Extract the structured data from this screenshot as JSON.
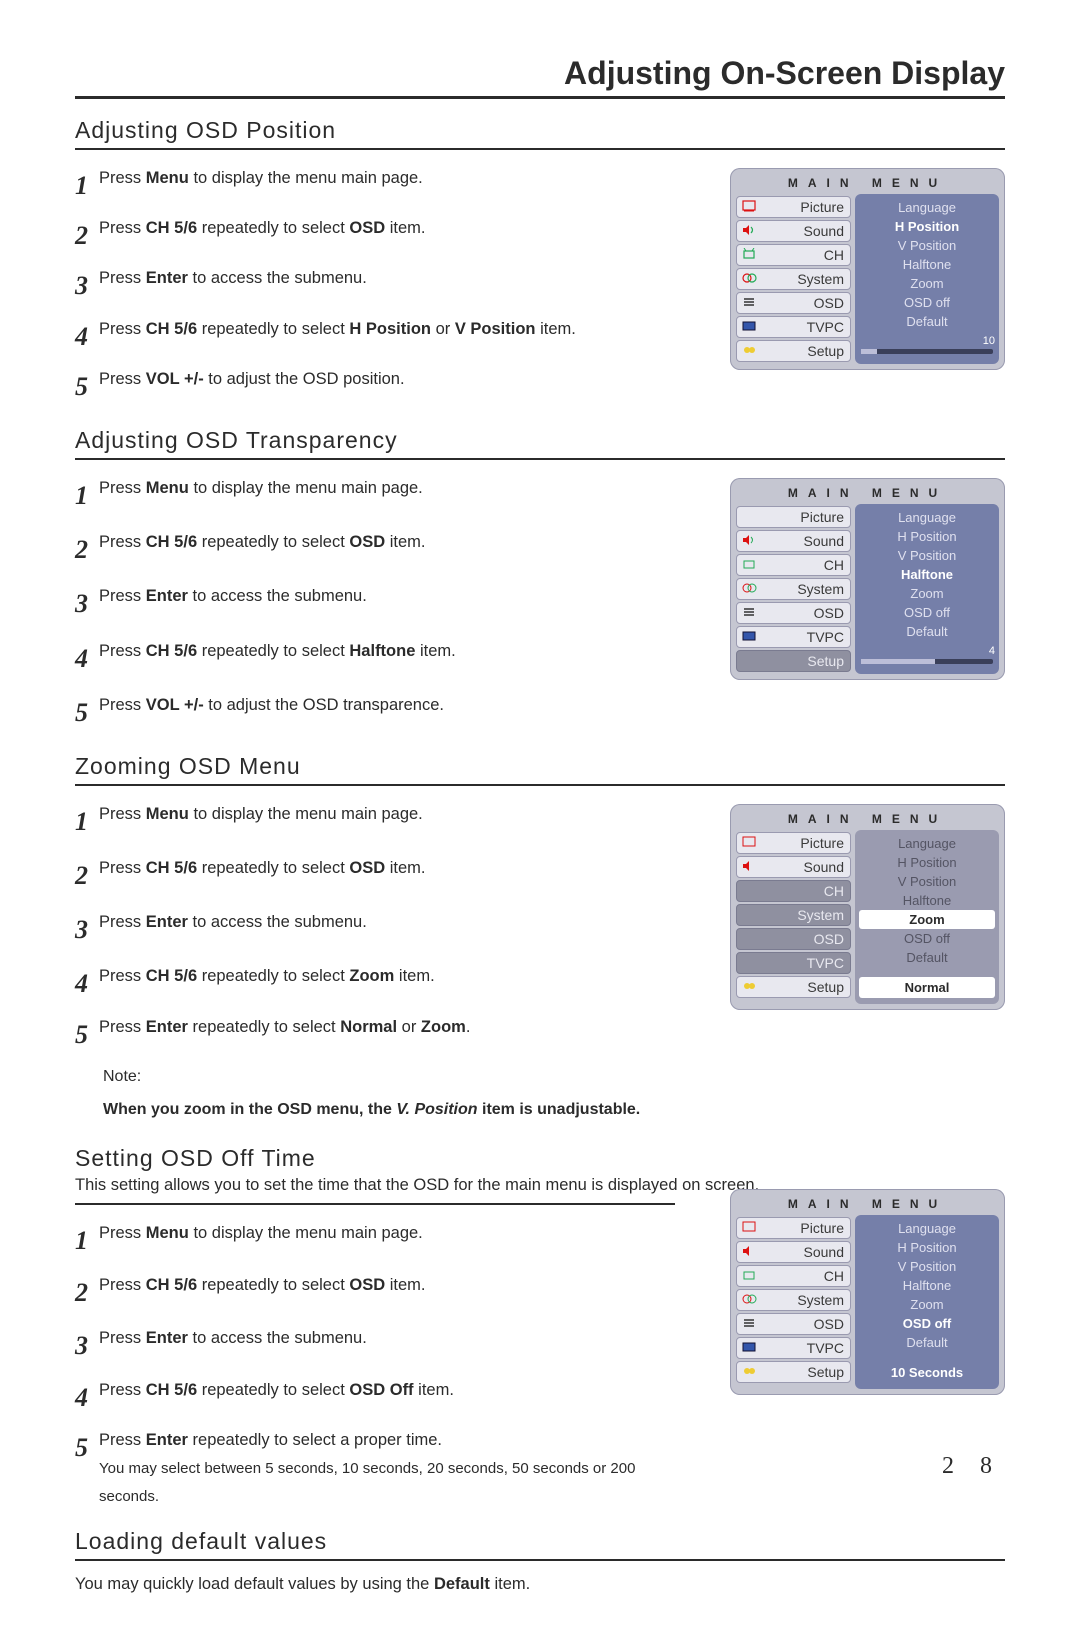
{
  "page": {
    "main_title": "Adjusting On-Screen Display",
    "number": "2 8"
  },
  "osd_common": {
    "header": "MAIN MENU",
    "menu_items": [
      "Picture",
      "Sound",
      "CH",
      "System",
      "OSD",
      "TVPC",
      "Setup"
    ],
    "submenu_items": [
      "Language",
      "H Position",
      "V Position",
      "Halftone",
      "Zoom",
      "OSD off",
      "Default"
    ]
  },
  "osd1": {
    "selected_sub": "H Position",
    "value": "10",
    "fill_pct": 12
  },
  "osd2": {
    "selected_sub": "Halftone",
    "value": "4",
    "fill_pct": 56
  },
  "osd3": {
    "selected_sub": "Zoom",
    "zoom_value": "Normal"
  },
  "osd4": {
    "selected_sub": "OSD off",
    "off_value": "10 Seconds"
  },
  "sec1": {
    "title": "Adjusting OSD Position",
    "s1a": "Press ",
    "s1b": "Menu",
    "s1c": " to display the menu main page.",
    "s2a": "Press ",
    "s2b": "CH 5/6",
    "s2c": " repeatedly to select ",
    "s2d": "OSD",
    "s2e": " item.",
    "s3a": "Press ",
    "s3b": "Enter",
    "s3c": " to access the submenu.",
    "s4a": "Press ",
    "s4b": "CH 5/6",
    "s4c": " repeatedly to select ",
    "s4d": "H Position",
    "s4e": " or ",
    "s4f": "V Position",
    "s4g": " item.",
    "s5a": "Press ",
    "s5b": "VOL +/-",
    "s5c": " to adjust the OSD position."
  },
  "sec2": {
    "title": "Adjusting OSD Transparency",
    "s1a": "Press ",
    "s1b": "Menu",
    "s1c": " to display the menu main page.",
    "s2a": "Press ",
    "s2b": "CH 5/6",
    "s2c": " repeatedly to select ",
    "s2d": "OSD",
    "s2e": " item.",
    "s3a": "Press ",
    "s3b": "Enter",
    "s3c": " to access the submenu.",
    "s4a": "Press ",
    "s4b": "CH 5/6",
    "s4c": " repeatedly to select ",
    "s4d": "Halftone",
    "s4e": " item.",
    "s5a": "Press ",
    "s5b": "VOL +/-",
    "s5c": " to adjust the OSD transparence."
  },
  "sec3": {
    "title": "Zooming OSD Menu",
    "s1a": "Press ",
    "s1b": "Menu",
    "s1c": " to display the menu main page.",
    "s2a": "Press ",
    "s2b": "CH 5/6",
    "s2c": " repeatedly to select ",
    "s2d": "OSD",
    "s2e": " item.",
    "s3a": "Press ",
    "s3b": "Enter",
    "s3c": " to access the submenu.",
    "s4a": "Press ",
    "s4b": "CH 5/6",
    "s4c": " repeatedly to select ",
    "s4d": "Zoom",
    "s4e": " item.",
    "s5a": "Press ",
    "s5b": "Enter",
    "s5c": " repeatedly to select ",
    "s5d": "Normal",
    "s5e": " or ",
    "s5f": "Zoom",
    "s5g": ".",
    "note_lead": "Note:",
    "note_a": "When you zoom in the OSD menu, the ",
    "note_b": "V. Position",
    "note_c": " item is unadjustable."
  },
  "sec4": {
    "title": "Setting OSD Off Time",
    "intro": "This setting allows you to set the time that the OSD for the main menu is displayed on screen.",
    "s1a": "Press ",
    "s1b": "Menu",
    "s1c": " to display the menu main page.",
    "s2a": "Press ",
    "s2b": "CH 5/6",
    "s2c": " repeatedly to select ",
    "s2d": "OSD",
    "s2e": " item.",
    "s3a": "Press ",
    "s3b": "Enter",
    "s3c": " to access the submenu.",
    "s4a": "Press ",
    "s4b": "CH 5/6",
    "s4c": " repeatedly to select ",
    "s4d": "OSD Off",
    "s4e": " item.",
    "s5a": "Press ",
    "s5b": "Enter",
    "s5c": " repeatedly to select a proper time.",
    "s5_sub": "You may select between 5 seconds, 10 seconds, 20 seconds, 50 seconds or 200 seconds."
  },
  "sec5": {
    "title": "Loading default values",
    "p1a": "You may quickly load default values by using the ",
    "p1b": "Default",
    "p1c": " item."
  },
  "nums": {
    "n1": "1",
    "n2": "2",
    "n3": "3",
    "n4": "4",
    "n5": "5"
  }
}
